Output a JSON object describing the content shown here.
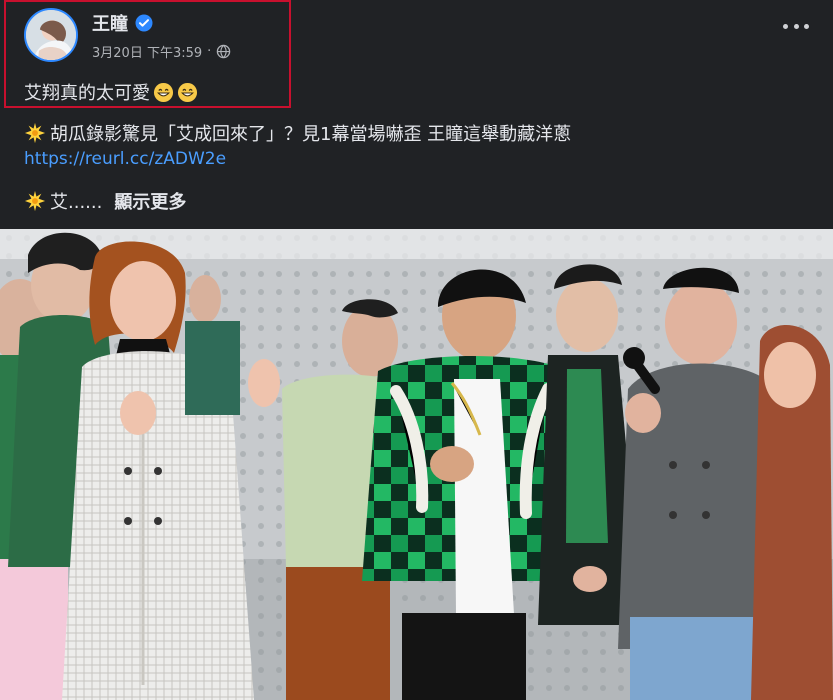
{
  "post": {
    "author": "王瞳",
    "date_time": "3月20日 下午3:59",
    "separator": "·",
    "caption": "艾翔真的太可愛",
    "emojis": [
      "grinning-face-icon",
      "grinning-face-icon"
    ],
    "headline": "胡瓜錄影驚見「艾成回來了」？見1幕當場嚇歪 王瞳這舉動藏洋蔥",
    "link": "https://reurl.cc/zADW2e",
    "excerpt": "艾......",
    "show_more": "顯示更多"
  },
  "colors": {
    "highlight": "#c8102e",
    "link": "#4a9eff",
    "verified": "#2d88ff",
    "background": "#202225"
  },
  "icons": {
    "verified": "verified-badge-icon",
    "globe": "globe-icon",
    "more": "more-options-icon",
    "bullet": "sparkle-sun-icon"
  }
}
